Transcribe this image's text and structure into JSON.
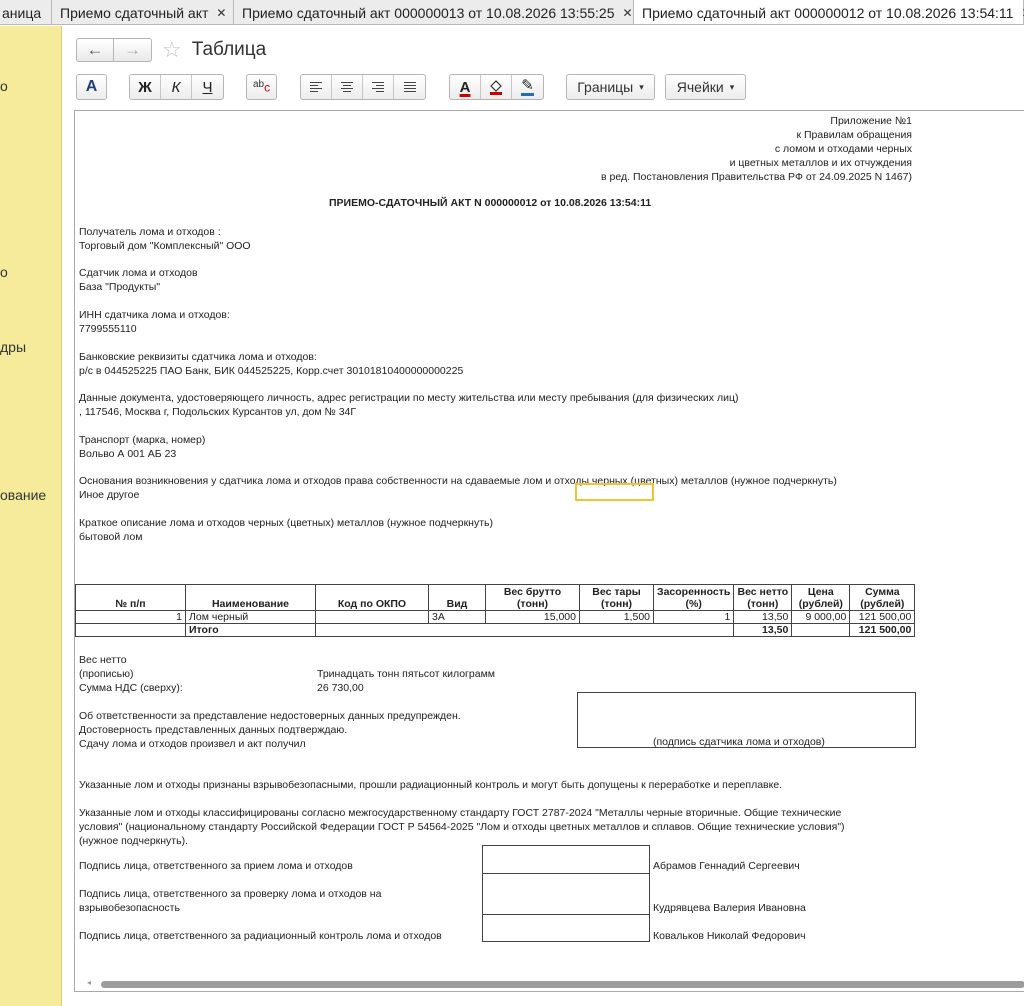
{
  "tabs": [
    {
      "label": "аница"
    },
    {
      "label": "Приемо сдаточный акт",
      "close": "✕"
    },
    {
      "label": "Приемо сдаточный акт 000000013 от 10.08.2026 13:55:25",
      "close": "✕"
    },
    {
      "label": "Приемо сдаточный акт 000000012 от 10.08.2026 13:54:11",
      "close": "✕"
    }
  ],
  "sidebar": {
    "items": [
      "о",
      "о",
      "дры",
      "ование"
    ]
  },
  "header": {
    "back": "←",
    "forward": "→",
    "star": "☆",
    "title": "Таблица"
  },
  "toolbar": {
    "font_a": "A",
    "bold": "Ж",
    "italic": "К",
    "underline": "Ч",
    "spell_top": "ab",
    "spell_bottom": "c",
    "text_color": "A",
    "pencil": "✎",
    "borders": "Границы",
    "cells": "Ячейки",
    "dropdown": "▾"
  },
  "document": {
    "appendix": [
      "Приложение №1",
      "к Правилам обращения",
      "с ломом и отходами черных",
      "и цветных металлов и их отчуждения",
      "в ред. Постановления Правительства РФ от 24.09.2025 N 1467)"
    ],
    "title": "ПРИЕМО-СДАТОЧНЫЙ АКТ N 000000012 от 10.08.2026 13:54:11",
    "recipient_label": "Получатель лома и отходов   :",
    "recipient": "Торговый дом \"Комплексный\" ООО",
    "seller_label": "Сдатчик лома и отходов",
    "seller": "База \"Продукты\"",
    "inn_label": "ИНН сдатчика лома и отходов:",
    "inn": "7799555110",
    "bank_label": "Банковские реквизиты сдатчика лома и отходов:",
    "bank": "р/с  в 044525225 ПАО Банк, БИК 044525225, Корр.счет 30101810400000000225",
    "identity_label": "Данные документа, удостоверяющего личность, адрес регистрации по месту жительства или месту пребывания (для физических лиц)",
    "identity": " , 117546, Москва г, Подольских Курсантов ул, дом № 34Г",
    "transport_label": "Транспорт (марка, номер)",
    "transport": "Вольво А 001 АБ 23",
    "basis_label": "Основания возникновения у сдатчика лома и отходов права собственности на сдаваемые лом и отходы черных (цветных) металлов (нужное подчеркнуть)",
    "basis": "Иное другое",
    "desc_label": "Краткое описание лома и отходов черных (цветных) металлов (нужное подчеркнуть)",
    "desc": "бытовой лом",
    "table": {
      "headers": [
        "№ п/п",
        "Наименование",
        "Код по ОКПО",
        "Вид",
        "Вес брутто (тонн)",
        "Вес тары (тонн)",
        "Засоренность (%)",
        "Вес нетто (тонн)",
        "Цена (рублей)",
        "Сумма (рублей)"
      ],
      "rows": [
        {
          "n": "1",
          "name": "Лом черный",
          "okpo": "",
          "kind": "3А",
          "gross": "15,000",
          "tare": "1,500",
          "litter": "1",
          "net": "13,50",
          "price": "9 000,00",
          "sum": "121 500,00"
        }
      ],
      "total": {
        "label": "Итого",
        "net": "13,50",
        "sum": "121 500,00"
      }
    },
    "net_label_1": "Вес нетто",
    "net_label_2": "(прописью)",
    "net_words": "Тринадцать тонн пятьсот килограмм",
    "vat_label": "Сумма НДС (сверху):",
    "vat": "26 730,00",
    "resp_1": "Об ответственности за представление недостоверных данных предупрежден.",
    "resp_2": "Достоверность представленных данных подтверждаю.",
    "resp_3": "Сдачу лома и отходов произвел и акт получил",
    "seller_sign": "(подпись сдатчика лома и отходов)",
    "safety_note": "Указанные лом и отходы признаны взрывобезопасными, прошли радиационный контроль и могут быть допущены к переработке и переплавке.",
    "gost_1": "Указанные лом и отходы классифицированы согласно межгосударственному стандарту ГОСТ 2787-2024 \"Металлы черные вторичные. Общие технические",
    "gost_2": "условия\" (национальному стандарту Российской Федерации ГОСТ Р 54564-2025 \"Лом и отходы цветных металлов и сплавов. Общие технические условия\")",
    "gost_3": "(нужное подчеркнуть).",
    "sign_accept_label": "Подпись лица, ответственного за прием лома и отходов",
    "sign_accept_name": "Абрамов Геннадий Сергеевич",
    "sign_explosion_label_1": "Подпись лица, ответственного за проверку лома и отходов на",
    "sign_explosion_label_2": "взрывобезопасность",
    "sign_explosion_name": "Кудрявцева Валерия Ивановна",
    "sign_radiation_label": "Подпись лица, ответственного за радиационный контроль лома и отходов",
    "sign_radiation_name": "Ковальков Николай Федорович"
  },
  "scroll_arrow": "◂"
}
